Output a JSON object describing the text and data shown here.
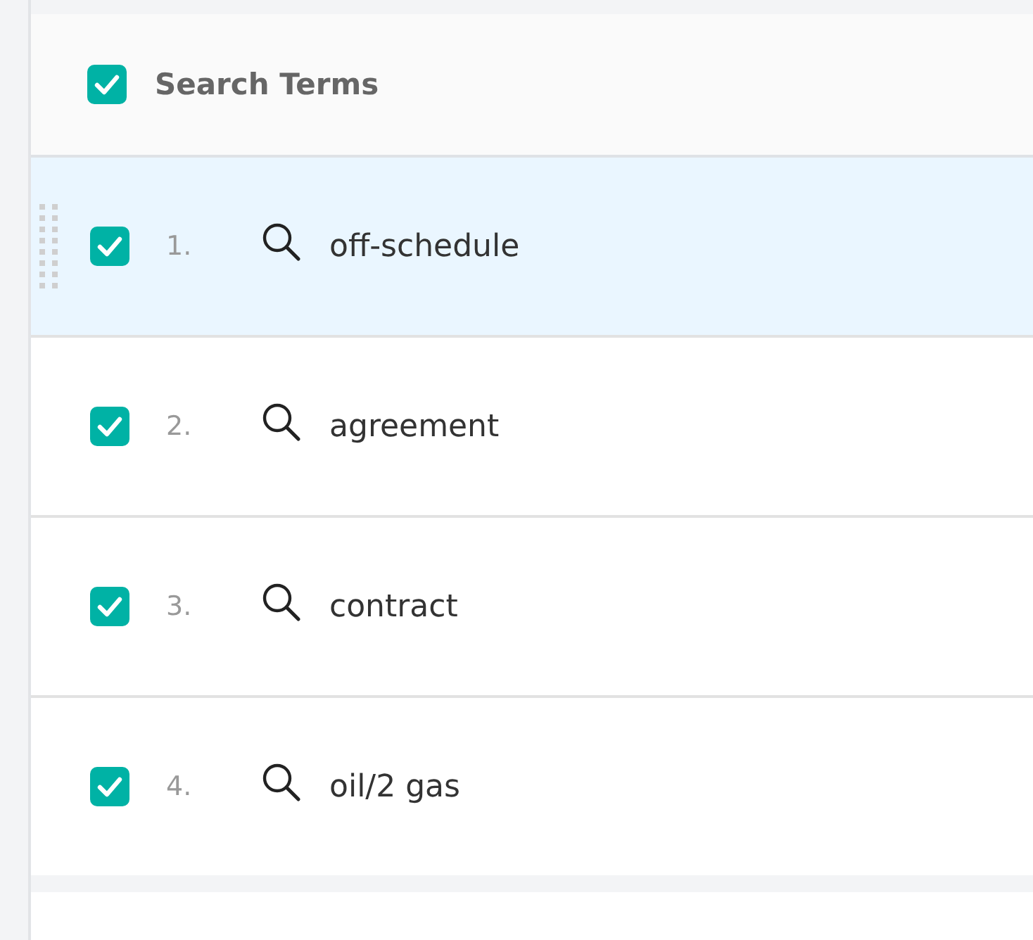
{
  "header": {
    "checked": true,
    "label": "Search Terms"
  },
  "terms": [
    {
      "number": "1.",
      "term": "off-schedule",
      "checked": true,
      "selected": true
    },
    {
      "number": "2.",
      "term": "agreement",
      "checked": true,
      "selected": false
    },
    {
      "number": "3.",
      "term": "contract",
      "checked": true,
      "selected": false
    },
    {
      "number": "4.",
      "term": "oil/2 gas",
      "checked": true,
      "selected": false
    }
  ]
}
